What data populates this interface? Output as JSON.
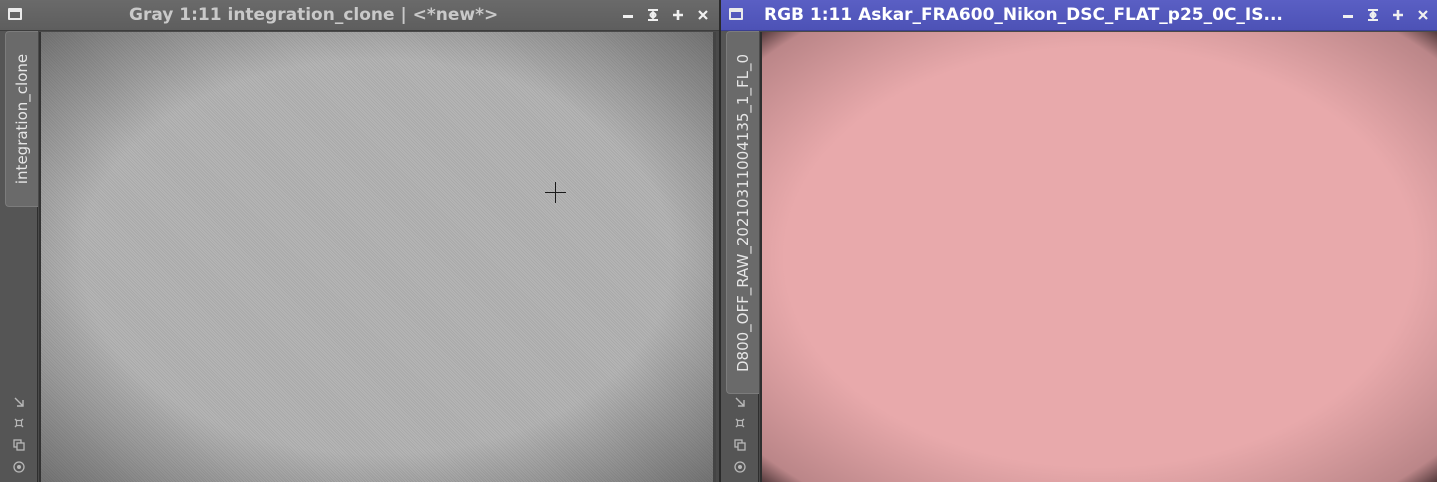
{
  "left_window": {
    "title": "Gray 1:11 integration_clone | <*new*>",
    "tab_label": "integration_clone",
    "accent": "#5e5e5e"
  },
  "right_window": {
    "title": "RGB 1:11 Askar_FRA600_Nikon_DSC_FLAT_p25_0C_IS...",
    "tab_label": "D800_OFF_RAW_20210311004135_1_FL_0",
    "accent": "#5055bb",
    "image_tint": "#e8a9ab"
  },
  "titlebar_buttons": [
    "minimize-icon",
    "shade-icon",
    "maximize-icon",
    "close-icon"
  ],
  "sidebar_icons": [
    "fit-view-icon",
    "zoom-to-fit-icon",
    "clone-icon",
    "mask-icon"
  ]
}
